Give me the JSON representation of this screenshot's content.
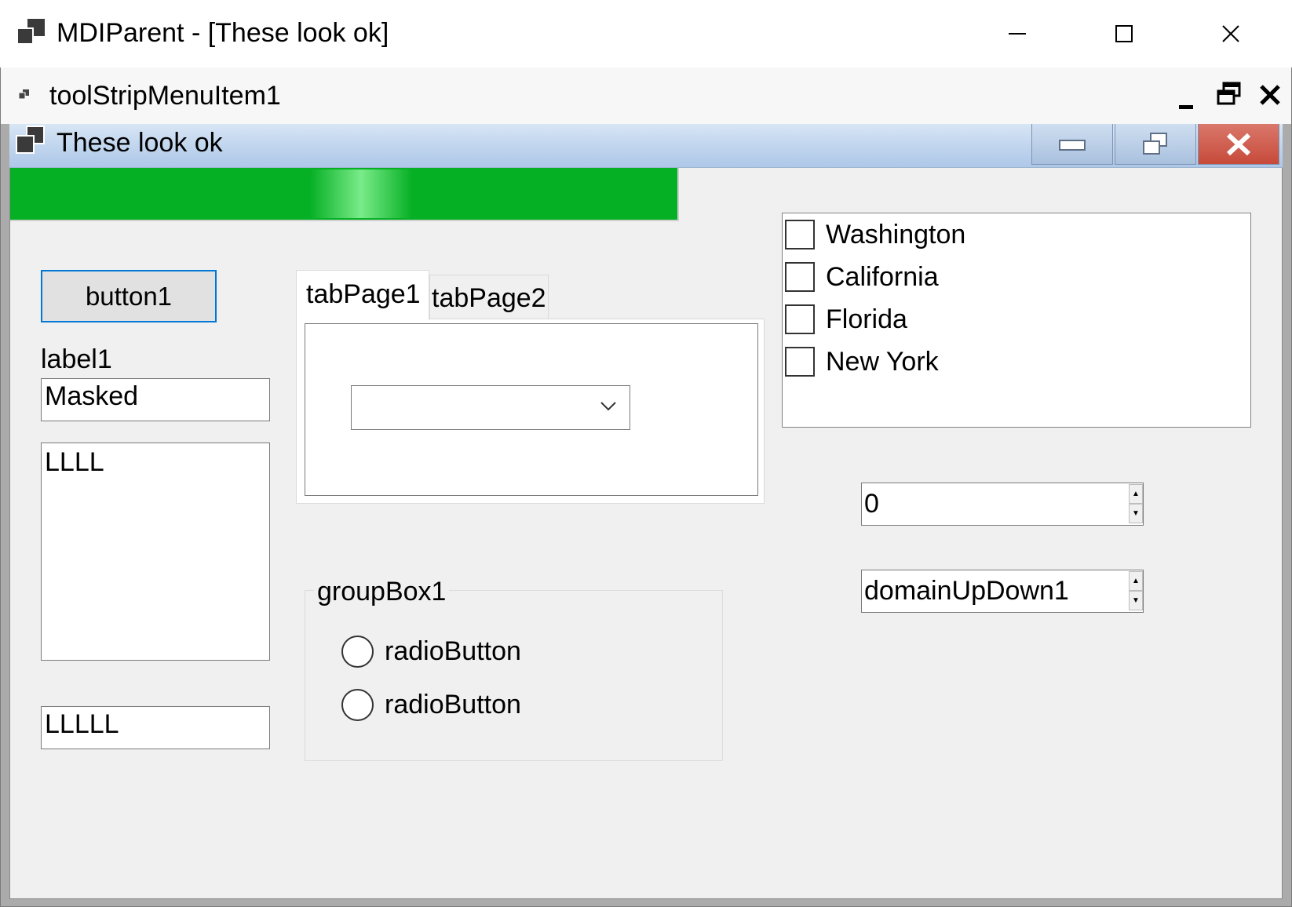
{
  "window": {
    "title": "MDIParent - [These look ok]",
    "icon": "app-window-icon",
    "caption_buttons": [
      "minimize",
      "maximize",
      "close"
    ]
  },
  "menu": {
    "item_label": "toolStripMenuItem1",
    "mdi_buttons": [
      "minimize",
      "restore",
      "close"
    ]
  },
  "child": {
    "title": "These look ok",
    "icon": "app-window-icon",
    "caption_buttons": [
      "minimize",
      "restore",
      "close"
    ],
    "close_color": "#c74a3a"
  },
  "progress": {
    "value_percent": 100,
    "color": "#06b025"
  },
  "controls": {
    "button1": "button1",
    "label1": "label1",
    "masked_textbox_value": "Masked",
    "multiline_textbox_value": "LLLL",
    "bottom_textbox_value": "LLLLL"
  },
  "tabs": [
    {
      "label": "tabPage1",
      "selected": true
    },
    {
      "label": "tabPage2",
      "selected": false
    }
  ],
  "combo": {
    "value": ""
  },
  "group_box": {
    "label": "groupBox1",
    "radios": [
      {
        "label": "radioButton",
        "checked": false
      },
      {
        "label": "radioButton",
        "checked": false
      }
    ]
  },
  "checked_list": {
    "items": [
      {
        "label": "Washington",
        "checked": false
      },
      {
        "label": "California",
        "checked": false
      },
      {
        "label": "Florida",
        "checked": false
      },
      {
        "label": "New York",
        "checked": false
      }
    ]
  },
  "numeric_updown": {
    "value": "0"
  },
  "domain_updown": {
    "value": "domainUpDown1"
  }
}
